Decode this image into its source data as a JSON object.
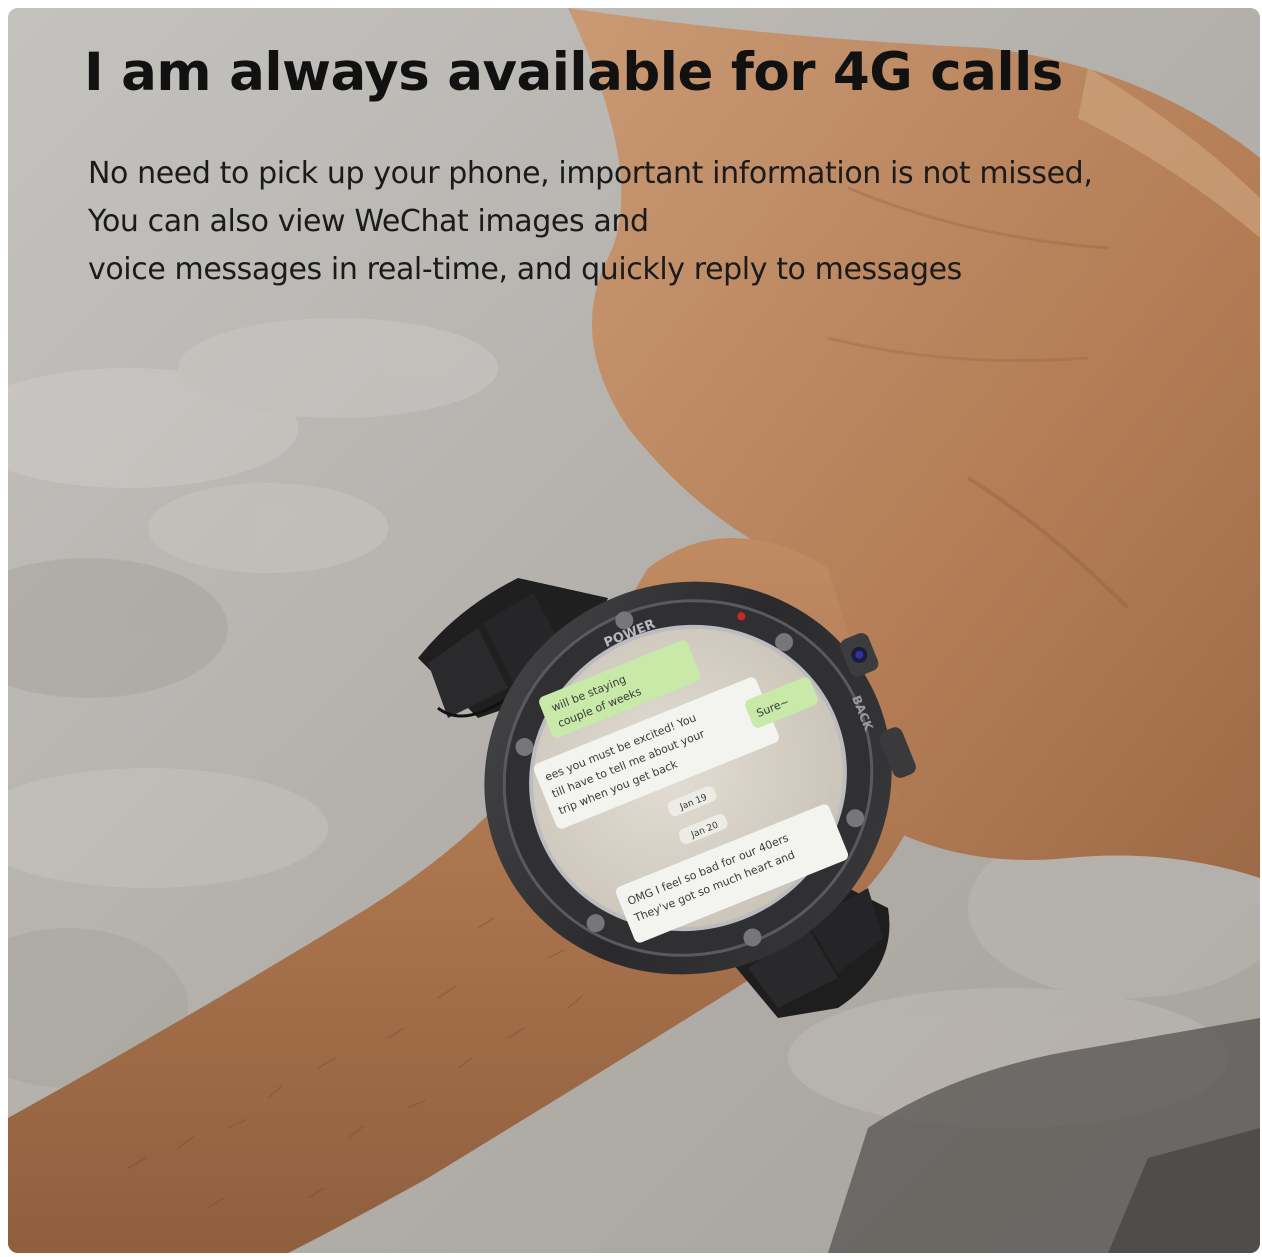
{
  "headline": "I am always available for 4G calls",
  "description": {
    "line1": "No need to pick up your phone, important information is not missed,",
    "line2": "You can also view WeChat images and",
    "line3": "voice messages in real-time, and quickly reply to messages"
  },
  "watch": {
    "bezel_label": "POWER",
    "side_label": "BACK",
    "screen_messages": [
      "will be staying",
      "couple of weeks",
      "ees you must be excited! You",
      "till have to tell me about your",
      "trip when you get back",
      "Jan 19",
      "Sure~",
      "Jan 20",
      "OMG I feel so bad for our 40ers",
      "They've got so much heart and"
    ]
  },
  "colors": {
    "background": "#b9b6b1",
    "headline": "#111111",
    "body_text": "#1b1b1b",
    "skin": "#b07a55",
    "watch_case": "#2c2c2e",
    "strap": "#1e1e1f",
    "chat_bubble_green": "#c9e9a8",
    "chat_bubble_white": "#f3f3ef",
    "screen": "#d9d4c9"
  }
}
